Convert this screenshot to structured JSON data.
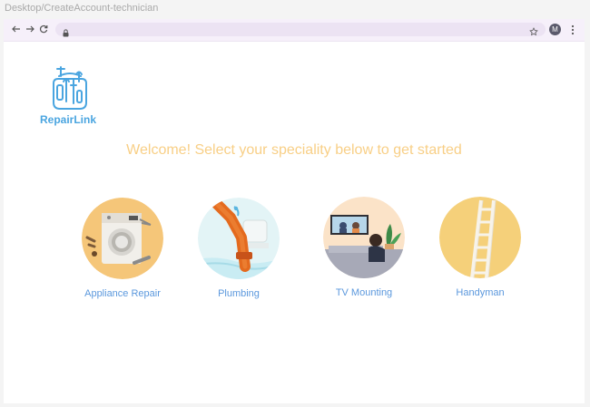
{
  "frame": {
    "title": "Desktop/CreateAccount-technician"
  },
  "browser": {
    "avatar_letter": "M"
  },
  "brand": {
    "name": "RepairLink"
  },
  "heading": "Welcome! Select your speciality below to get started",
  "colors": {
    "brand": "#4aa5e0",
    "heading": "#f8cf86",
    "label": "#5b98dd"
  },
  "specialities": [
    {
      "label": "Appliance Repair",
      "icon": "washing-machine"
    },
    {
      "label": "Plumbing",
      "icon": "pipe"
    },
    {
      "label": "TV Mounting",
      "icon": "tv-living-room"
    },
    {
      "label": "Handyman",
      "icon": "ladder"
    }
  ]
}
